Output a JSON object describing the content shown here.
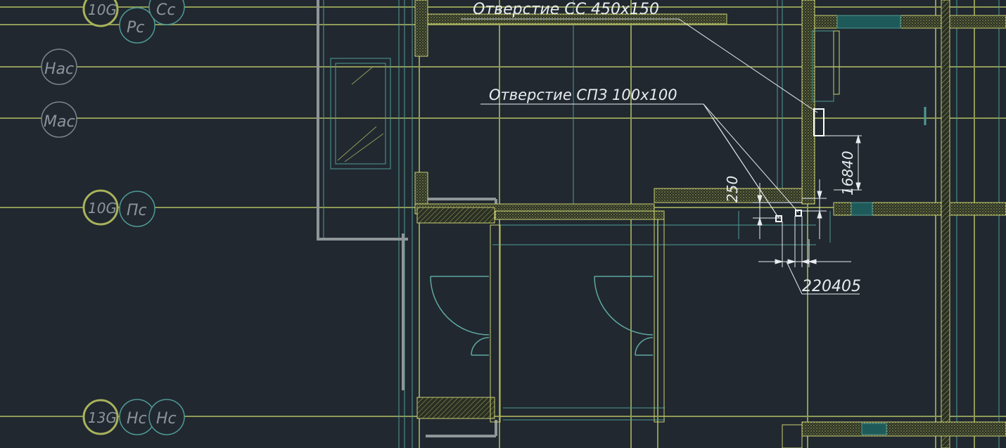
{
  "colors": {
    "background": "#212830",
    "grid": "#8f9a55",
    "wall": "#c9cf70",
    "hatch": "#9aa35a",
    "thin": "#4f9b96",
    "partition": "#8f9699",
    "annotation": "#e8ecef",
    "bubble_gray": "#7d858c",
    "bubble_olive": "#a8b35b",
    "door": "#5fa8a0"
  },
  "annotations": {
    "cc_opening": "Отверстие СС 450х150",
    "spz_opening": "Отверстие СПЗ 100х100"
  },
  "dimensions": {
    "d250": "250",
    "d16840": "16840",
    "d220405": "220405"
  },
  "bubbles": {
    "row1_a": "10G",
    "row1_b": "Рс",
    "row1_c": "Сс",
    "row2": "Нас",
    "row3": "Мас",
    "row4_a": "10G",
    "row4_b": "Пс",
    "row5_a": "13G",
    "row5_b": "Нс",
    "row5_c": "Нс"
  }
}
